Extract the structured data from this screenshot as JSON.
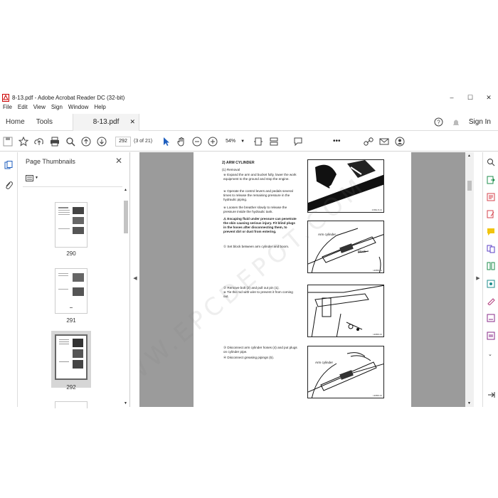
{
  "window": {
    "title": "8-13.pdf - Adobe Acrobat Reader DC (32-bit)",
    "min": "–",
    "max": "☐",
    "close": "✕"
  },
  "menu": [
    "File",
    "Edit",
    "View",
    "Sign",
    "Window",
    "Help"
  ],
  "tabs": {
    "home": "Home",
    "tools": "Tools",
    "doc_tab": "8-13.pdf",
    "doc_close": "✕",
    "sign_in": "Sign In"
  },
  "toolbar": {
    "page_number": "292",
    "page_count": "(3 of 21)",
    "zoom": "54%"
  },
  "thumbnails": {
    "title": "Page Thumbnails",
    "close": "✕",
    "pages": [
      {
        "label": "290",
        "selected": false
      },
      {
        "label": "291",
        "selected": false
      },
      {
        "label": "292",
        "selected": true
      }
    ]
  },
  "document": {
    "section_title": "2) ARM CYLINDER",
    "removal_heading": "(1) Removal",
    "bullets": [
      "Expand the arm and bucket fully, lower the work equipment to the ground and stop the engine.",
      "Operate the control levers and pedals several times to release the remaining pressure in the hydraulic piping.",
      "Loosen the breather slowly to release the pressure inside the hydraulic tank."
    ],
    "warning": "Escaping fluid under pressure can penetrate the skin causing serious injury. Fit blind plugs in the hoses after disconnecting them, to prevent dirt or dust from entering.",
    "step1": "① Set block between arm cylinder and boom.",
    "step2": "② Remove bolt (2) and pull out pin (1).",
    "step2b": "※ Tie the rod with wire to prevent it from coming out.",
    "step3": "③ Disconnect arm cylinder hoses (4) and put plugs on cylinder pipe.",
    "step4": "④ Disconnect greasing pipings (5).",
    "fig_labels": {
      "arm_cylinder_1": "Arm cylinder",
      "block": "Block",
      "arm_cylinder_2": "Arm cylinder"
    },
    "fig_codes": [
      "13RE-8-14",
      "HMB8-14",
      "HMB8-33",
      "HMB8-33"
    ],
    "watermark": "WWW.EPCDEPOT.COM"
  }
}
